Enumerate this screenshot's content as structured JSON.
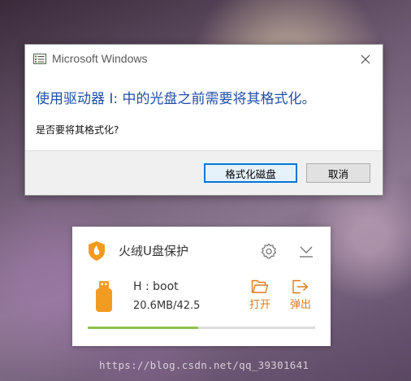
{
  "dialog": {
    "title": "Microsoft Windows",
    "heading": "使用驱动器 I: 中的光盘之前需要将其格式化。",
    "message": "是否要将其格式化?",
    "primary_button": "格式化磁盘",
    "secondary_button": "取消"
  },
  "widget": {
    "title": "火绒U盘保护",
    "drive_name": "H : boot",
    "drive_size": "20.6MB/42.5",
    "open_label": "打开",
    "eject_label": "弹出",
    "usage_fraction": 0.485,
    "accent_color": "#e07b1a",
    "bar_color": "#8cc34b"
  },
  "watermark": "https://blog.csdn.net/qq_39301641"
}
